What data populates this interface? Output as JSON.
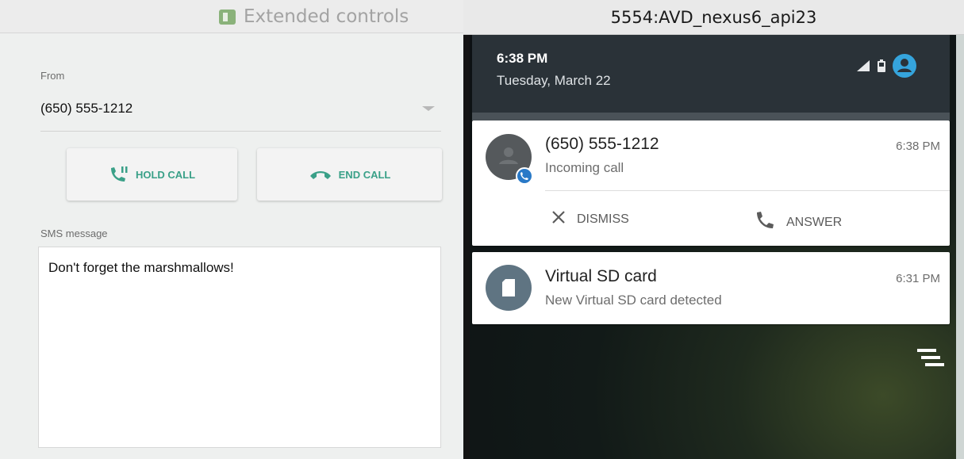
{
  "extended_controls": {
    "window_title": "Extended controls",
    "from_label": "From",
    "from_value": "(650) 555-1212",
    "hold_call_label": "HOLD CALL",
    "end_call_label": "END CALL",
    "sms_label": "SMS message",
    "sms_value": "Don't forget the marshmallows!"
  },
  "emulator": {
    "window_title": "5554:AVD_nexus6_api23",
    "status_time": "6:38 PM",
    "status_date": "Tuesday, March 22",
    "notifications": [
      {
        "title": "(650) 555-1212",
        "subtitle": "Incoming call",
        "time": "6:38 PM",
        "actions": [
          "DISMISS",
          "ANSWER"
        ]
      },
      {
        "title": "Virtual SD card",
        "subtitle": "New Virtual SD card detected",
        "time": "6:31 PM"
      }
    ]
  },
  "colors": {
    "accent_green": "#3aa088",
    "badge_blue": "#2979c7",
    "shade_dark": "#2a3238"
  },
  "icons": [
    "extended-controls-icon",
    "dropdown-arrow-icon",
    "hold-call-icon",
    "end-call-icon",
    "signal-icon",
    "battery-icon",
    "account-icon",
    "contact-avatar-icon",
    "phone-badge-icon",
    "close-icon",
    "phone-icon",
    "sd-card-icon",
    "clear-all-icon"
  ]
}
